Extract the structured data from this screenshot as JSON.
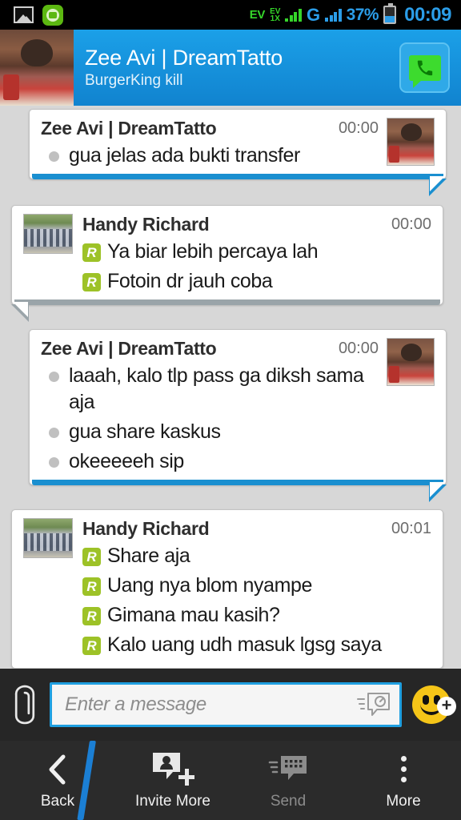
{
  "statusbar": {
    "icons_left": [
      "gallery-icon",
      "green-app-icon"
    ],
    "network_ev": "EV",
    "network_ev_1x_top": "EV",
    "network_ev_1x_bottom": "1X",
    "network_g": "G",
    "battery_percent": "37%",
    "clock": "00:09"
  },
  "header": {
    "title": "Zee Avi | DreamTatto",
    "subtitle": "BurgerKing kill",
    "call_button": "voice-call-icon",
    "accent": "#1ba0e8"
  },
  "chat": {
    "bubbles": [
      {
        "side": "right",
        "sender": "Zee Avi | DreamTatto",
        "time": "00:00",
        "marker": "bullet",
        "accent": "#1a8fd0",
        "messages": [
          "gua jelas ada bukti transfer"
        ]
      },
      {
        "side": "left",
        "sender": "Handy Richard",
        "time": "00:00",
        "marker": "R",
        "accent": "#9aa4a9",
        "messages": [
          "Ya biar lebih percaya lah",
          "Fotoin dr jauh coba"
        ]
      },
      {
        "side": "right",
        "sender": "Zee Avi | DreamTatto",
        "time": "00:00",
        "marker": "bullet",
        "accent": "#1a8fd0",
        "messages": [
          "laaah, kalo tlp pass ga diksh sama aja",
          "gua share kaskus",
          "okeeeeeh sip"
        ]
      },
      {
        "side": "left",
        "sender": "Handy Richard",
        "time": "00:01",
        "marker": "R",
        "accent": "#9aa4a9",
        "messages": [
          "Share aja",
          "Uang nya blom nyampe",
          "Gimana mau kasih?",
          "Kalo uang udh masuk lgsg saya"
        ]
      }
    ],
    "read_badge_label": "R",
    "read_badge_color": "#9dc227"
  },
  "input": {
    "attach_icon": "paperclip-icon",
    "placeholder": "Enter a message",
    "value": "",
    "quick_reply_icon": "quick-message-icon",
    "emoji_icon": "smiley-icon",
    "emoji_add_label": "+"
  },
  "nav": {
    "items": [
      {
        "label": "Back",
        "icon": "chevron-left-icon",
        "enabled": true
      },
      {
        "label": "Invite More",
        "icon": "invite-person-icon",
        "enabled": true
      },
      {
        "label": "Send",
        "icon": "bbm-send-icon",
        "enabled": false
      },
      {
        "label": "More",
        "icon": "overflow-dots-icon",
        "enabled": true
      }
    ]
  }
}
